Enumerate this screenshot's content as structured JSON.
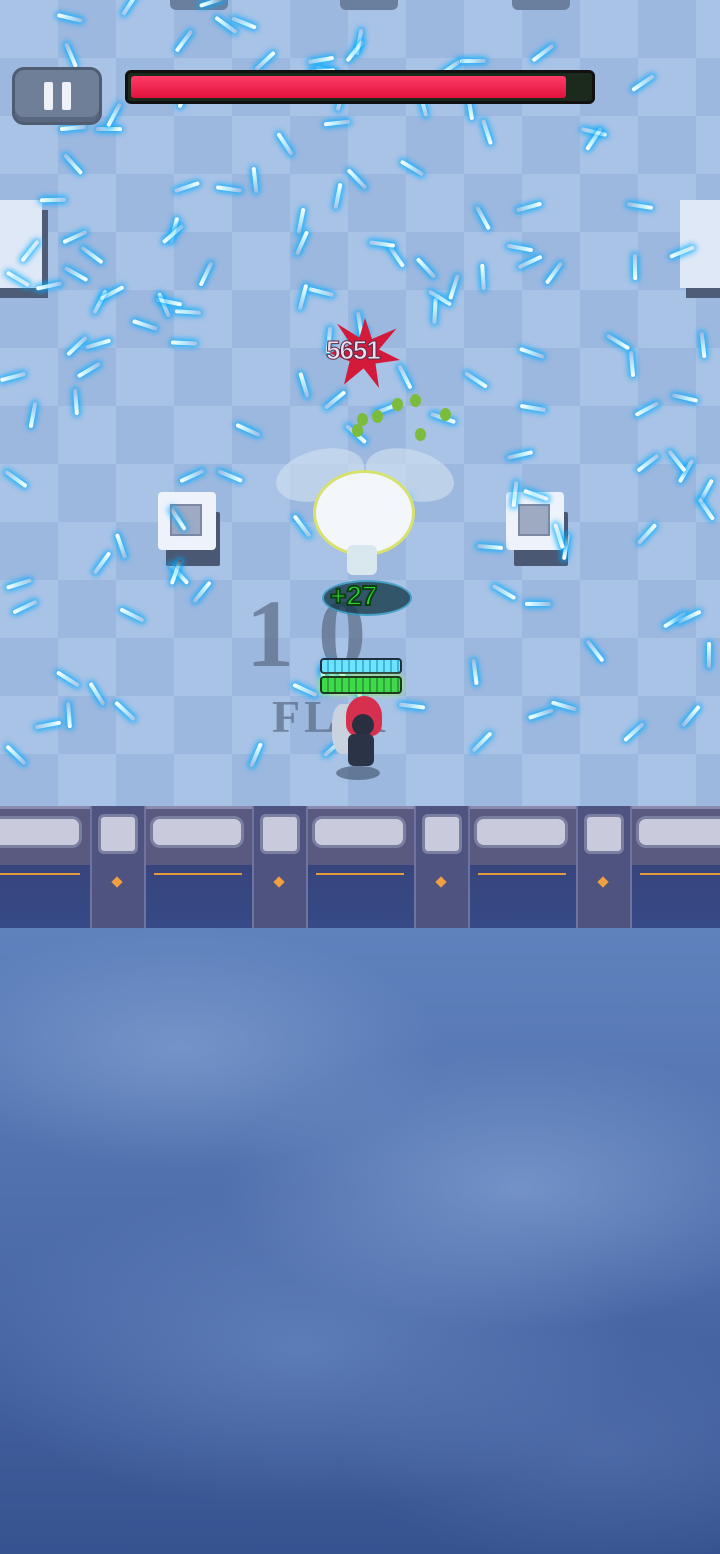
{
  "hud": {
    "pause_icon": "pause-icon",
    "boss_health_fraction": 0.95,
    "boss_health_color": "#e8143f"
  },
  "combat": {
    "damage_number": "5651",
    "heal_number": "+27",
    "player_shield_fraction": 1.0,
    "player_health_fraction": 1.0
  },
  "floor": {
    "number": "1 0",
    "label": "FL  R"
  },
  "colors": {
    "projectile": "#6fe6ff",
    "heal": "#2fd23a",
    "damage": "#d41a3a"
  }
}
